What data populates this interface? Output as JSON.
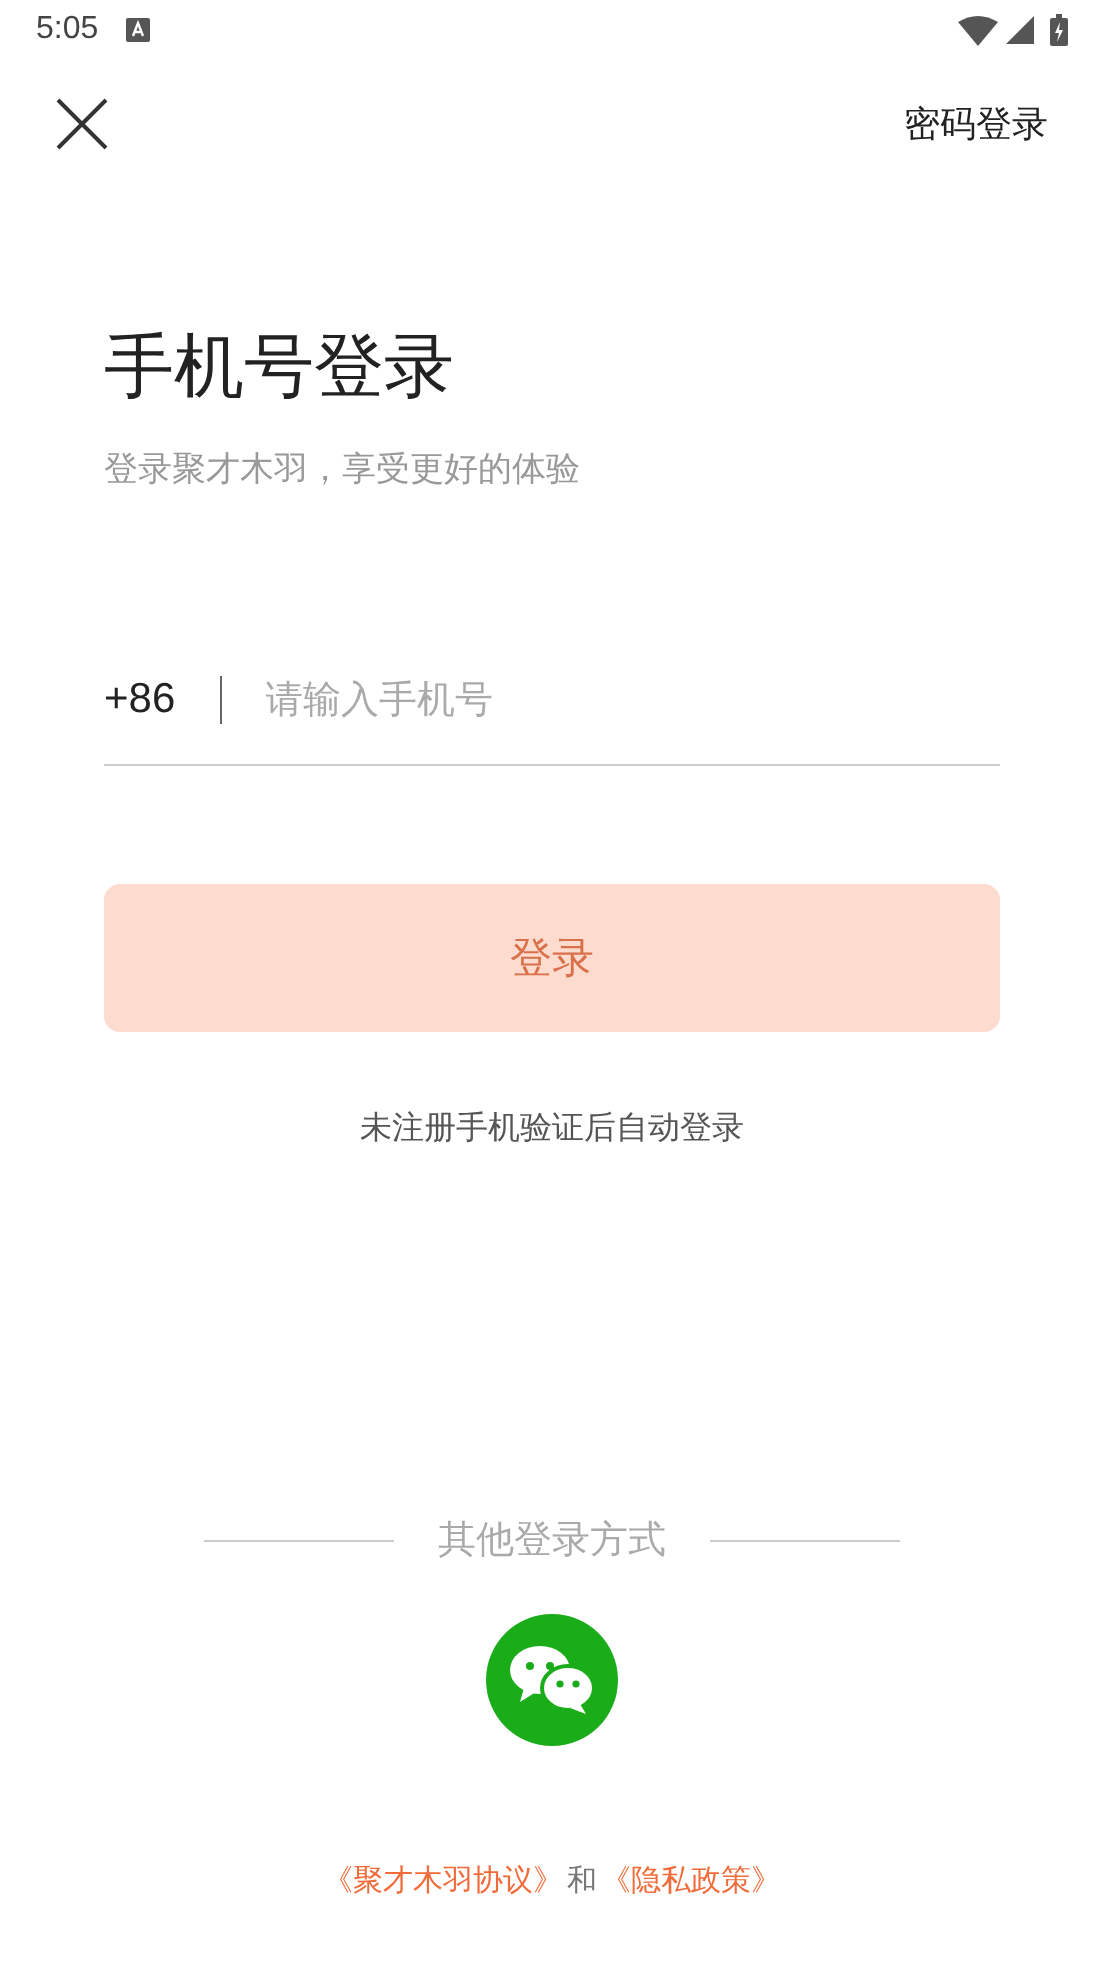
{
  "status_bar": {
    "time": "5:05"
  },
  "top_bar": {
    "password_login": "密码登录"
  },
  "title": "手机号登录",
  "subtitle": "登录聚才木羽，享受更好的体验",
  "phone_field": {
    "country_code": "+86",
    "placeholder": "请输入手机号"
  },
  "login_button": {
    "label": "登录",
    "disabled": true
  },
  "hint": "未注册手机验证后自动登录",
  "other_login": {
    "label": "其他登录方式"
  },
  "agreement": {
    "user_agreement": "《聚才木羽协议》",
    "and": "和",
    "privacy_policy": "《隐私政策》"
  }
}
